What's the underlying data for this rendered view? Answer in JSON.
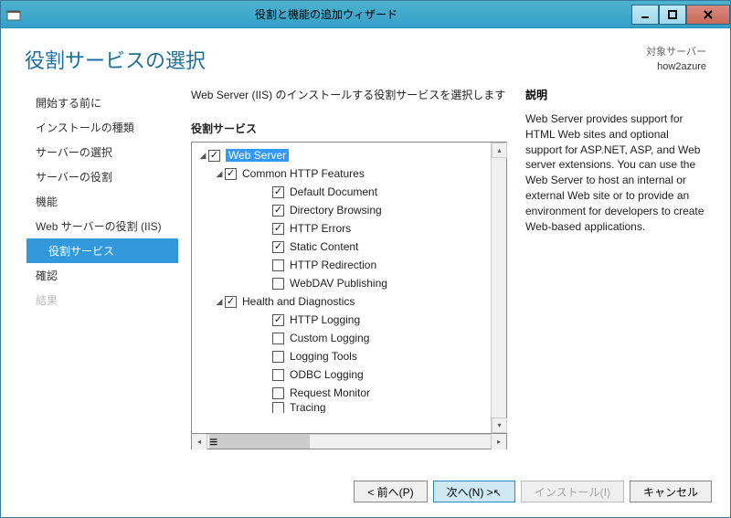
{
  "window": {
    "title": "役割と機能の追加ウィザード"
  },
  "header": {
    "page_title": "役割サービスの選択",
    "server_label": "対象サーバー",
    "server_name": "how2azure"
  },
  "sidebar": {
    "items": [
      {
        "label": "開始する前に"
      },
      {
        "label": "インストールの種類"
      },
      {
        "label": "サーバーの選択"
      },
      {
        "label": "サーバーの役割"
      },
      {
        "label": "機能"
      },
      {
        "label": "Web サーバーの役割 (IIS)"
      },
      {
        "label": "役割サービス",
        "selected": true,
        "sub": true
      },
      {
        "label": "確認"
      },
      {
        "label": "結果",
        "disabled": true
      }
    ]
  },
  "center": {
    "instruction": "Web Server (IIS) のインストールする役割サービスを選択します",
    "section_title": "役割サービス",
    "nodes": [
      {
        "level": 0,
        "expander": "◢",
        "checked": true,
        "label": "Web Server",
        "selected": true
      },
      {
        "level": 1,
        "expander": "◢",
        "checked": true,
        "label": "Common HTTP Features"
      },
      {
        "level": 2,
        "checked": true,
        "label": "Default Document"
      },
      {
        "level": 2,
        "checked": true,
        "label": "Directory Browsing"
      },
      {
        "level": 2,
        "checked": true,
        "label": "HTTP Errors"
      },
      {
        "level": 2,
        "checked": true,
        "label": "Static Content"
      },
      {
        "level": 2,
        "checked": false,
        "label": "HTTP Redirection"
      },
      {
        "level": 2,
        "checked": false,
        "label": "WebDAV Publishing"
      },
      {
        "level": 1,
        "expander": "◢",
        "checked": true,
        "label": "Health and Diagnostics"
      },
      {
        "level": 2,
        "checked": true,
        "label": "HTTP Logging"
      },
      {
        "level": 2,
        "checked": false,
        "label": "Custom Logging"
      },
      {
        "level": 2,
        "checked": false,
        "label": "Logging Tools"
      },
      {
        "level": 2,
        "checked": false,
        "label": "ODBC Logging"
      },
      {
        "level": 2,
        "checked": false,
        "label": "Request Monitor"
      },
      {
        "level": 2,
        "checked": false,
        "label": "Tracing",
        "cut": true
      }
    ]
  },
  "right": {
    "heading": "説明",
    "body": "Web Server provides support for HTML Web sites and optional support for ASP.NET, ASP, and Web server extensions. You can use the Web Server to host an internal or external Web site or to provide an environment for developers to create Web-based applications."
  },
  "buttons": {
    "prev": "< 前へ(P)",
    "next": "次へ(N) >",
    "install": "インストール(I)",
    "cancel": "キャンセル"
  }
}
